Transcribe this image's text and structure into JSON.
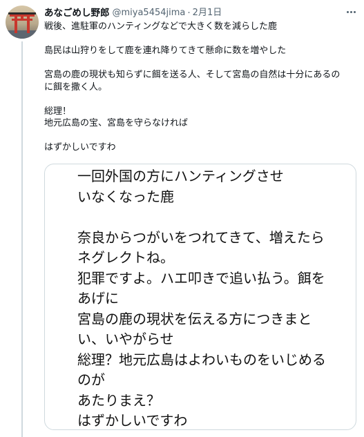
{
  "author": {
    "name": "あなごめし野郎",
    "handle": "@miya5454jima",
    "separator": "·",
    "date": "2月1日"
  },
  "tweet": {
    "paragraphs": [
      [
        "戦後、進駐軍のハンティングなどで大きく数を減らした鹿"
      ],
      [
        "島民は山狩りをして鹿を連れ降りてきて懸命に数を増やした"
      ],
      [
        "宮島の鹿の現状も知らずに餌を送る人、そして宮島の自然は十分にあるの",
        "に餌を撒く人。"
      ],
      [
        "総理！",
        "地元広島の宝、宮島を守らなければ"
      ],
      [
        "はずかしいですわ"
      ]
    ]
  },
  "card": {
    "lines": [
      "一回外国の方にハンティングさせ",
      "いなくなった鹿",
      "",
      "奈良からつがいをつれてきて、増えたら",
      "ネグレクトね。",
      "犯罪ですよ。ハエ叩きで追い払う。餌を",
      "あげに",
      "宮島の鹿の現状を伝える方につきまと",
      "い、いやがらせ",
      "総理？地元広島はよわいものをいじめる",
      "のが",
      "あたりまえ？",
      "はずかしいですわ"
    ]
  },
  "icons": {
    "avatar": "torii-gate-avatar-icon",
    "more": "more-options-icon"
  },
  "colors": {
    "text": "#0f1419",
    "secondary": "#536471",
    "border": "#cfd9de",
    "torii": "#c8372d"
  }
}
